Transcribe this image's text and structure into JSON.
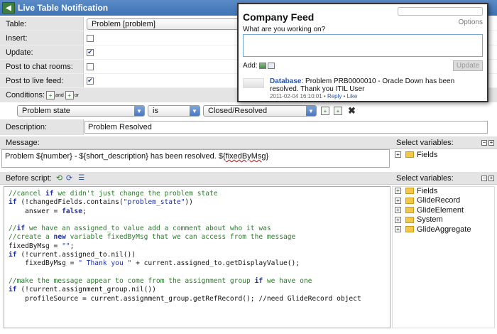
{
  "window": {
    "title": "Live Table Notification"
  },
  "form": {
    "table_label": "Table:",
    "table_value": "Problem [problem]",
    "insert_label": "Insert:",
    "insert_checked": false,
    "update_label": "Update:",
    "update_checked": true,
    "chat_label": "Post to chat rooms:",
    "chat_checked": false,
    "feed_label": "Post to live feed:",
    "feed_checked": true,
    "conditions_label": "Conditions:",
    "and_label": "and",
    "or_label": "or",
    "condition": {
      "field": "Problem state",
      "operator": "is",
      "value": "Closed/Resolved"
    },
    "description_label": "Description:",
    "description_value": "Problem Resolved",
    "message_label": "Message:",
    "message_prefix": "Problem ${number} - ${short_description} has been resolved. ${",
    "message_var": "fixedByMsg",
    "message_suffix": "}",
    "before_script_label": "Before script:",
    "select_variables_label": "Select variables:",
    "message_tree": [
      "Fields"
    ],
    "script_tree": [
      "Fields",
      "GlideRecord",
      "GlideElement",
      "System",
      "GlideAggregate"
    ]
  },
  "script_lines": [
    [
      [
        "cm",
        "//cancel "
      ],
      [
        "kw",
        "if"
      ],
      [
        "cm",
        " we didn't just change the problem state"
      ]
    ],
    [
      [
        "kw",
        "if"
      ],
      [
        "",
        " (!changedFields.contains("
      ],
      [
        "str",
        "\"problem_state\""
      ],
      [
        "",
        "))"
      ]
    ],
    [
      [
        "",
        "    answer = "
      ],
      [
        "kw",
        "false"
      ],
      [
        "",
        ";"
      ]
    ],
    [
      [
        "",
        ""
      ]
    ],
    [
      [
        "cm",
        "//"
      ],
      [
        "kw",
        "if"
      ],
      [
        "cm",
        " we have an assigned_to value add a comment about who it was"
      ]
    ],
    [
      [
        "cm",
        "//create a "
      ],
      [
        "kw",
        "new"
      ],
      [
        "cm",
        " variable fixedByMsg that we can access from the message"
      ]
    ],
    [
      [
        "",
        "fixedByMsg = "
      ],
      [
        "str",
        "\"\""
      ],
      [
        "",
        ";"
      ]
    ],
    [
      [
        "kw",
        "if"
      ],
      [
        "",
        " (!current.assigned_to.nil())"
      ]
    ],
    [
      [
        "",
        "    fixedByMsg = "
      ],
      [
        "str",
        "\" Thank you \""
      ],
      [
        "",
        " + current.assigned_to.getDisplayValue();"
      ]
    ],
    [
      [
        "",
        ""
      ]
    ],
    [
      [
        "cm",
        "//make the message appear to come from the assignment group "
      ],
      [
        "kw",
        "if"
      ],
      [
        "cm",
        " we have one"
      ]
    ],
    [
      [
        "kw",
        "if"
      ],
      [
        "",
        " (!current.assignment_group.nil())"
      ]
    ],
    [
      [
        "",
        "    profileSource = current.assignment_group.getRefRecord(); //need GlideRecord object"
      ]
    ]
  ],
  "feed_popup": {
    "title": "Company Feed",
    "options_label": "Options",
    "prompt": "What are you working on?",
    "add_label": "Add:",
    "update_label": "Update",
    "post_source": "Database",
    "post_text": ": Problem PRB0000010 - Oracle Down has been resolved. Thank you ITIL User",
    "post_time": "2011-02-04 16:10:01",
    "separator": " • ",
    "reply_label": "Reply",
    "like_label": "Like"
  },
  "colors": {
    "titlebar": "#3f73b5",
    "label_bg": "#e4e4e4",
    "link": "#2a55b0"
  }
}
